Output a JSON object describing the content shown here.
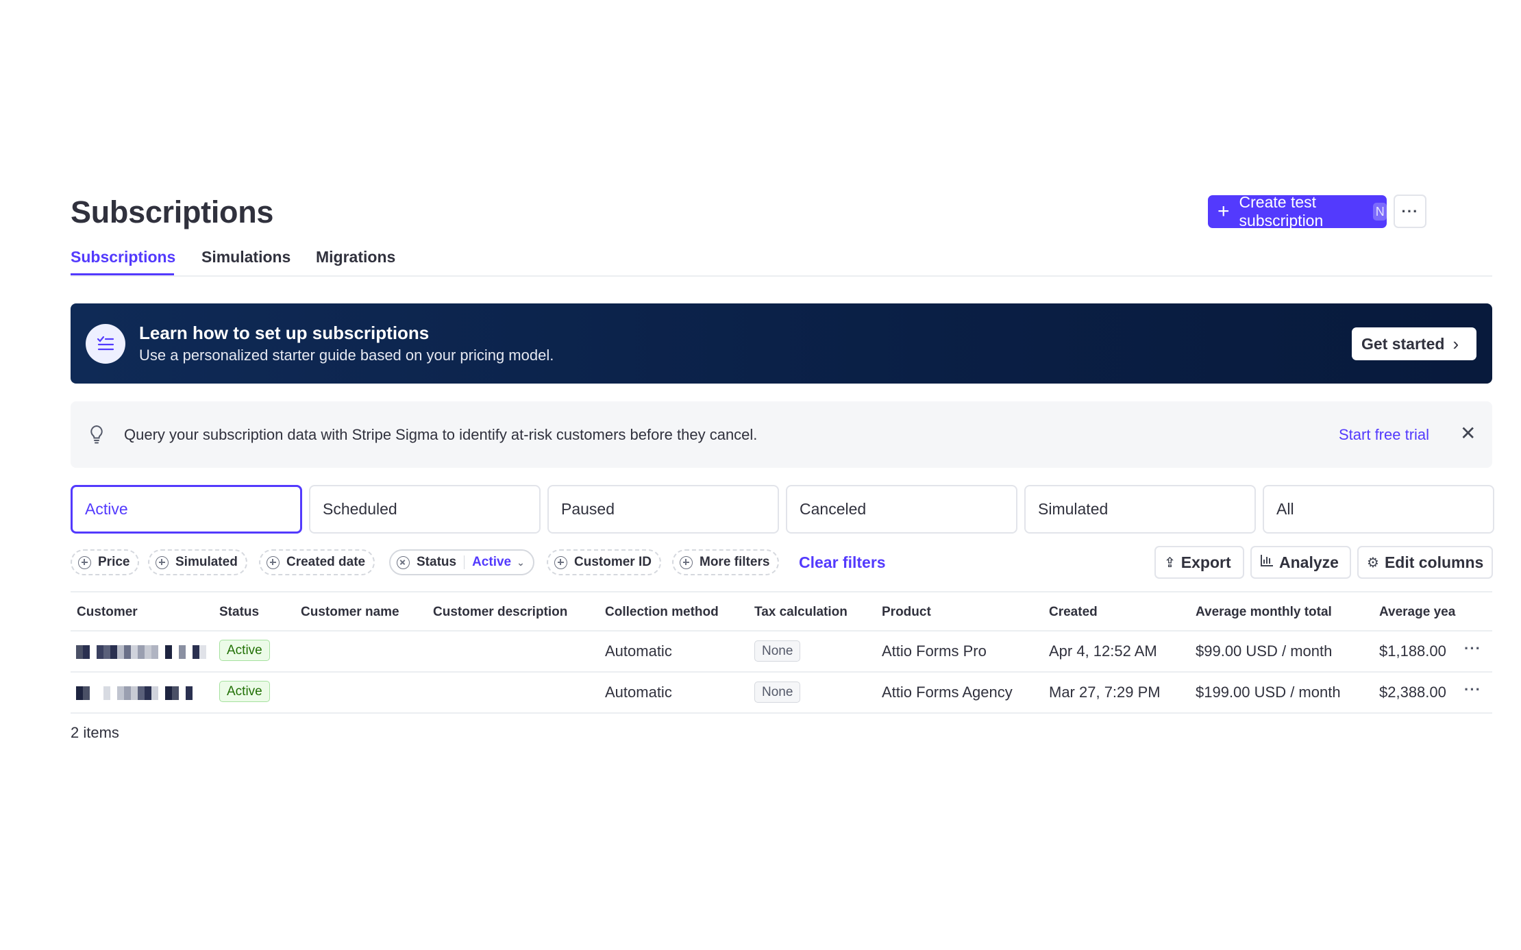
{
  "page": {
    "title": "Subscriptions"
  },
  "header": {
    "create_button": "Create test subscription",
    "create_shortcut": "N",
    "more_button": "···"
  },
  "tabs": [
    {
      "label": "Subscriptions",
      "active": true
    },
    {
      "label": "Simulations",
      "active": false
    },
    {
      "label": "Migrations",
      "active": false
    }
  ],
  "banner": {
    "title": "Learn how to set up subscriptions",
    "subtitle": "Use a personalized starter guide based on your pricing model.",
    "button": "Get started"
  },
  "notice": {
    "text": "Query your subscription data with Stripe Sigma to identify at-risk customers before they cancel.",
    "link": "Start free trial"
  },
  "segments": [
    {
      "label": "Active",
      "active": true
    },
    {
      "label": "Scheduled",
      "active": false
    },
    {
      "label": "Paused",
      "active": false
    },
    {
      "label": "Canceled",
      "active": false
    },
    {
      "label": "Simulated",
      "active": false
    },
    {
      "label": "All",
      "active": false
    }
  ],
  "filters": {
    "price": "Price",
    "simulated": "Simulated",
    "created_date": "Created date",
    "status": "Status",
    "status_value": "Active",
    "customer_id": "Customer ID",
    "more_filters": "More filters",
    "clear": "Clear filters"
  },
  "toolbar": {
    "export": "Export",
    "analyze": "Analyze",
    "edit_columns": "Edit columns"
  },
  "table": {
    "columns": [
      "Customer",
      "Status",
      "Customer name",
      "Customer description",
      "Collection method",
      "Tax calculation",
      "Product",
      "Created",
      "Average monthly total",
      "Average yea"
    ],
    "rows": [
      {
        "status": "Active",
        "collection_method": "Automatic",
        "tax": "None",
        "product": "Attio Forms Pro",
        "created": "Apr 4, 12:52 AM",
        "monthly": "$99.00 USD / month",
        "yearly": "$1,188.00"
      },
      {
        "status": "Active",
        "collection_method": "Automatic",
        "tax": "None",
        "product": "Attio Forms Agency",
        "created": "Mar 27, 7:29 PM",
        "monthly": "$199.00 USD / month",
        "yearly": "$2,388.00"
      }
    ],
    "row_more": "···",
    "count": "2 items"
  },
  "colors": {
    "accent": "#533afd",
    "banner": "#0d2550",
    "success": "#217005"
  }
}
